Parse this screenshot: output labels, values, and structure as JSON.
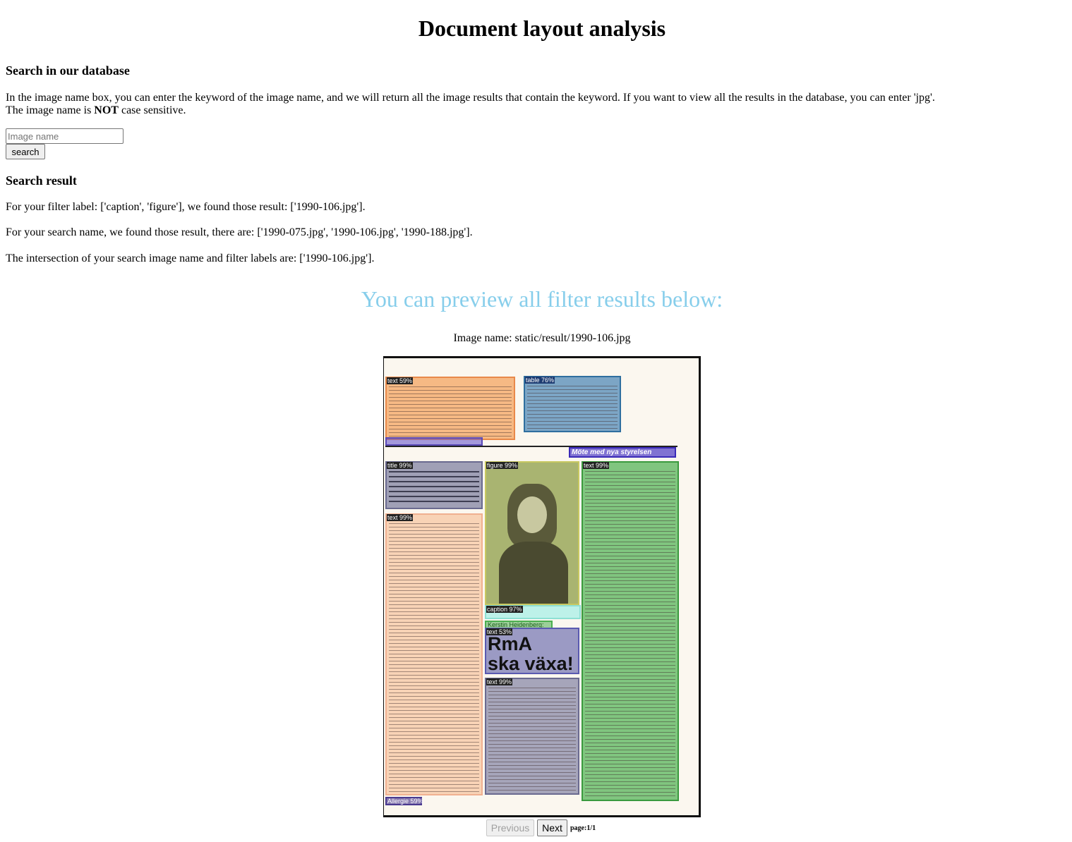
{
  "title": "Document layout analysis",
  "search_section": {
    "heading": "Search in our database",
    "description": "In the image name box, you can enter the keyword of the image name, and we will return all the image results that contain the keyword. If you want to view all the results in the database, you can enter 'jpg'.",
    "case_note_prefix": "The image name is ",
    "case_note_bold": "NOT",
    "case_note_suffix": " case sensitive.",
    "input_placeholder": "Image name",
    "input_value": "",
    "button_label": "search"
  },
  "result_section": {
    "heading": "Search result",
    "filter_text": "For your filter label: ['caption', 'figure'], we found those result: ['1990-106.jpg'].",
    "search_text": "For your search name, we found those result, there are: ['1990-075.jpg', '1990-106.jpg', '1990-188.jpg'].",
    "intersection_text": "The intersection of your search image name and filter labels are: ['1990-106.jpg']."
  },
  "preview": {
    "heading": "You can preview all filter results below:",
    "image_name": "Image name: static/result/1990-106.jpg",
    "labels": {
      "text_top": "text 59%",
      "table": "table 76%",
      "title": "title 99%",
      "figure": "figure 99%",
      "text_right": "text 99%",
      "text_left": "text 99%",
      "caption": "caption 97%",
      "text_mid": "text 99%",
      "text_small": "text 53%",
      "author": "Kerstin Heidenberg:",
      "headline_section": "Möte med nya styrelsen",
      "headline_big_1": "RmA",
      "headline_big_2": "ska växa!",
      "footer_tag": "Allergie 59%"
    },
    "colors": {
      "orange": "#f4a460",
      "blue": "#4682b4",
      "purple": "#6a5acd",
      "green": "#4caf50",
      "olive": "#9aa85a",
      "peach": "#f8c9a8",
      "slate": "#8a8aa8",
      "cyan": "#b2f0e8"
    }
  },
  "pagination": {
    "previous_label": "Previous",
    "next_label": "Next",
    "page_info": "page:1/1"
  }
}
